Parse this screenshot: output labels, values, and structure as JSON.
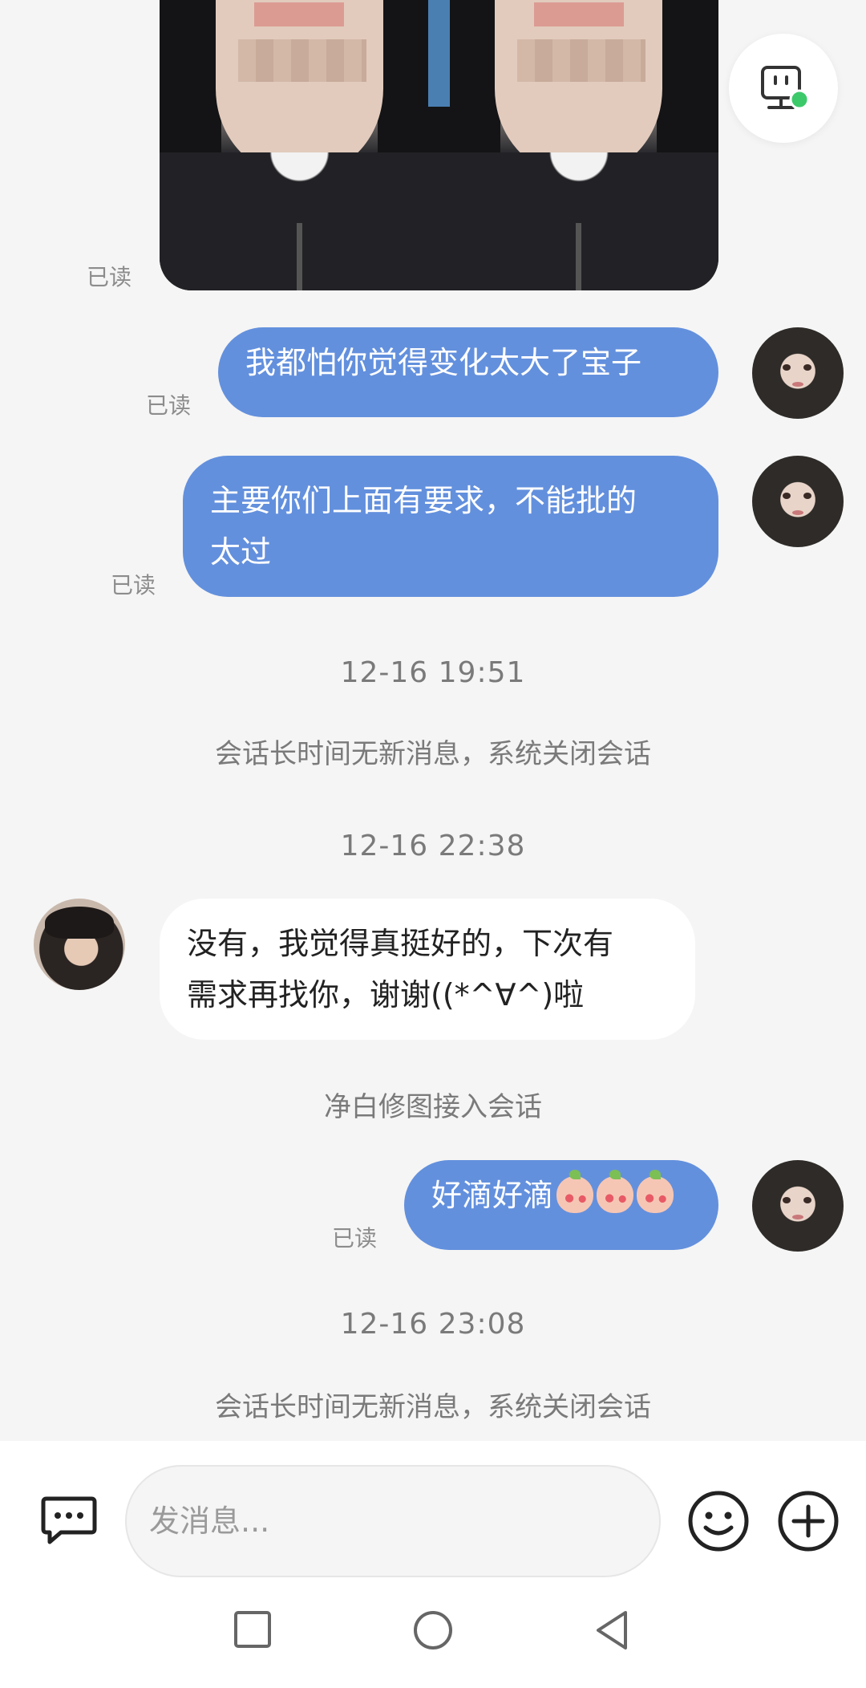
{
  "messages": {
    "read_label": "已读",
    "m1": "我都怕你觉得变化太大了宝子",
    "m2_line1": "主要你们上面有要求，不能批的",
    "m2_line2": "太过",
    "ts1": "12-16 19:51",
    "sys1": "会话长时间无新消息，系统关闭会话",
    "ts2": "12-16 22:38",
    "m3_line1": "没有，我觉得真挺好的，下次有",
    "m3_line2": "需求再找你，谢谢((*^∀^)啦",
    "sys2": "净白修图接入会话",
    "m4": "好滴好滴",
    "ts3": "12-16 23:08",
    "sys3": "会话长时间无新消息，系统关闭会话"
  },
  "input": {
    "placeholder": "发消息..."
  },
  "icons": {
    "robot": "robot-icon",
    "message": "message-icon",
    "emoji": "smiley-icon",
    "add": "plus-circle-icon",
    "nav_recent": "square-icon",
    "nav_home": "circle-icon",
    "nav_back": "triangle-back-icon"
  },
  "colors": {
    "my_bubble": "#6390dd",
    "background": "#f5f5f5",
    "online_dot": "#3cc96a"
  }
}
